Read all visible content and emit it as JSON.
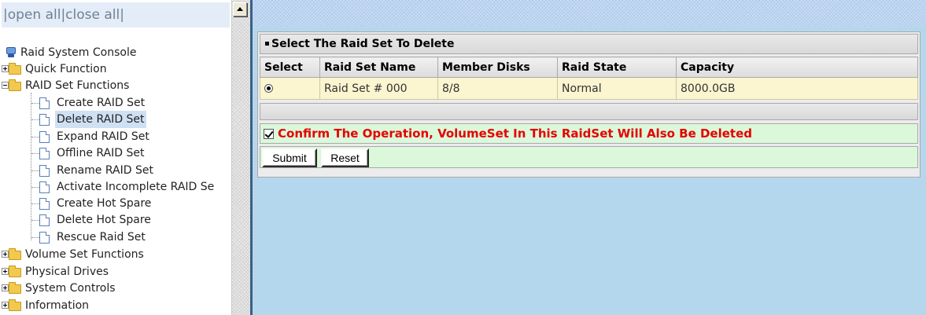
{
  "nav": {
    "open_all": "open all",
    "close_all": "close all",
    "separator": "|"
  },
  "tree": {
    "root": "Raid System Console",
    "items": [
      {
        "label": "Quick Function",
        "type": "folder",
        "expanded": false
      },
      {
        "label": "RAID Set Functions",
        "type": "folder",
        "expanded": true
      },
      {
        "label": "Create RAID Set",
        "type": "page"
      },
      {
        "label": "Delete RAID Set",
        "type": "page",
        "selected": true
      },
      {
        "label": "Expand RAID Set",
        "type": "page"
      },
      {
        "label": "Offline RAID Set",
        "type": "page"
      },
      {
        "label": "Rename RAID Set",
        "type": "page"
      },
      {
        "label": "Activate Incomplete RAID Se",
        "type": "page"
      },
      {
        "label": "Create Hot Spare",
        "type": "page"
      },
      {
        "label": "Delete Hot Spare",
        "type": "page"
      },
      {
        "label": "Rescue Raid Set",
        "type": "page"
      },
      {
        "label": "Volume Set Functions",
        "type": "folder",
        "expanded": false
      },
      {
        "label": "Physical Drives",
        "type": "folder",
        "expanded": false
      },
      {
        "label": "System Controls",
        "type": "folder",
        "expanded": false
      },
      {
        "label": "Information",
        "type": "folder",
        "expanded": false
      }
    ]
  },
  "panel": {
    "title": "Select The Raid Set To Delete",
    "columns": [
      "Select",
      "Raid Set Name",
      "Member Disks",
      "Raid State",
      "Capacity"
    ],
    "rows": [
      {
        "selected": true,
        "name": "Raid Set # 000",
        "member_disks": "8/8",
        "state": "Normal",
        "capacity": "8000.0GB"
      }
    ],
    "confirm_label": "Confirm The Operation, VolumeSet In This RaidSet Will Also Be Deleted",
    "confirm_checked": true,
    "submit_label": "Submit",
    "reset_label": "Reset"
  },
  "colors": {
    "confirm_text": "#e60000",
    "row_bg": "#fbf5d0",
    "action_bg": "#dbf8db",
    "content_bg": "#b5d7ee"
  }
}
